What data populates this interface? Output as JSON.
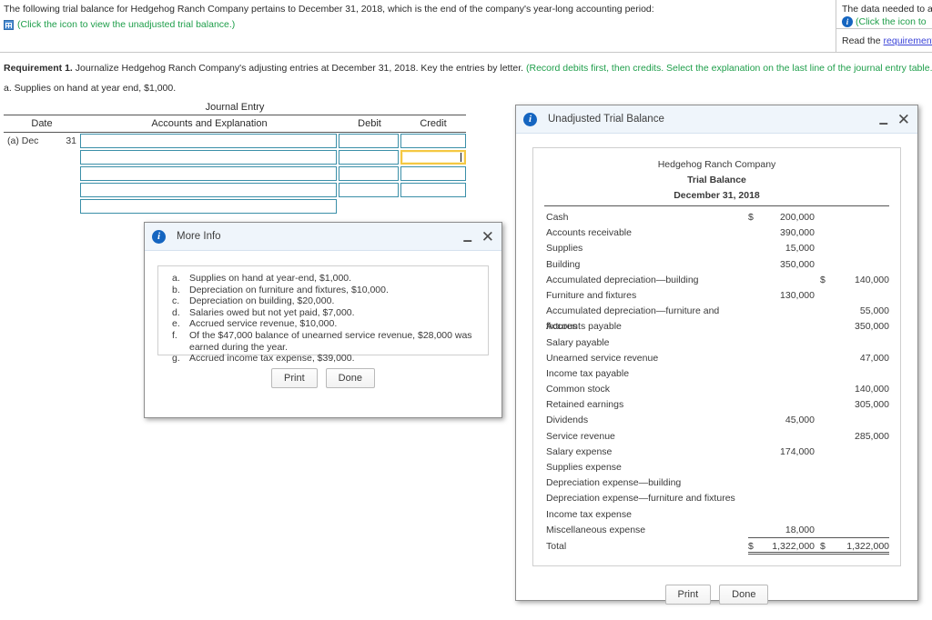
{
  "problem": {
    "statement": "The following trial balance for Hedgehog Ranch Company pertains to December 31, 2018, which is the end of the company's year-long accounting period:",
    "grid_icon": "table-grid-icon",
    "click_icon_text": "(Click the icon to view the unadjusted trial balance.)",
    "right_line1": "The data needed to a",
    "right_info_icon": "info-circle-icon",
    "right_click_text": "(Click the icon to",
    "right_read_prefix": "Read the ",
    "right_read_link": "requirement"
  },
  "requirement": {
    "label": "Requirement 1.",
    "text": " Journalize Hedgehog Ranch Company's adjusting entries at December 31, 2018. Key the entries by letter. ",
    "hint": "(Record debits first, then credits. Select the explanation on the last line of the journal entry table.)",
    "sub_item": "a. Supplies on hand at year end, $1,000."
  },
  "journal": {
    "title": "Journal Entry",
    "columns": {
      "date": "Date",
      "accounts": "Accounts and Explanation",
      "debit": "Debit",
      "credit": "Credit"
    },
    "rows": [
      {
        "date_label": "(a) Dec",
        "date_day": "31",
        "accounts_value": "",
        "debit_value": "",
        "credit_value": "",
        "has_amounts": true,
        "focused": ""
      },
      {
        "date_label": "",
        "date_day": "",
        "accounts_value": "",
        "debit_value": "",
        "credit_value": "",
        "has_amounts": true,
        "focused": "credit"
      },
      {
        "date_label": "",
        "date_day": "",
        "accounts_value": "",
        "debit_value": "",
        "credit_value": "",
        "has_amounts": true,
        "focused": ""
      },
      {
        "date_label": "",
        "date_day": "",
        "accounts_value": "",
        "debit_value": "",
        "credit_value": "",
        "has_amounts": true,
        "focused": ""
      },
      {
        "date_label": "",
        "date_day": "",
        "accounts_value": "",
        "debit_value": "",
        "credit_value": "",
        "has_amounts": false,
        "focused": ""
      }
    ]
  },
  "more_info_dialog": {
    "title": "More Info",
    "info_icon": "info-circle-icon",
    "minimize_glyph": "–",
    "close_glyph": "✕",
    "items": [
      {
        "key": "a.",
        "text": "Supplies on hand at year-end, $1,000."
      },
      {
        "key": "b.",
        "text": "Depreciation on furniture and fixtures, $10,000."
      },
      {
        "key": "c.",
        "text": "Depreciation on building, $20,000."
      },
      {
        "key": "d.",
        "text": "Salaries owed but not yet paid, $7,000."
      },
      {
        "key": "e.",
        "text": "Accrued service revenue, $10,000."
      },
      {
        "key": "f.",
        "text": "Of the $47,000 balance of unearned service revenue, $28,000 was earned during the year."
      },
      {
        "key": "g.",
        "text": "Accrued income tax expense, $39,000."
      }
    ],
    "print_label": "Print",
    "done_label": "Done"
  },
  "trial_balance_dialog": {
    "title": "Unadjusted Trial Balance",
    "info_icon": "info-circle-icon",
    "minimize_glyph": "–",
    "close_glyph": "✕",
    "company": "Hedgehog Ranch Company",
    "report": "Trial Balance",
    "date": "December 31, 2018",
    "rows": [
      {
        "name": "Cash",
        "debit_sym": "$",
        "debit": "200,000",
        "credit_sym": "",
        "credit": ""
      },
      {
        "name": "Accounts receivable",
        "debit_sym": "",
        "debit": "390,000",
        "credit_sym": "",
        "credit": ""
      },
      {
        "name": "Supplies",
        "debit_sym": "",
        "debit": "15,000",
        "credit_sym": "",
        "credit": ""
      },
      {
        "name": "Building",
        "debit_sym": "",
        "debit": "350,000",
        "credit_sym": "",
        "credit": ""
      },
      {
        "name": "Accumulated depreciation—building",
        "debit_sym": "",
        "debit": "",
        "credit_sym": "$",
        "credit": "140,000"
      },
      {
        "name": "Furniture and fixtures",
        "debit_sym": "",
        "debit": "130,000",
        "credit_sym": "",
        "credit": ""
      },
      {
        "name": "Accumulated depreciation—furniture and fixtures",
        "debit_sym": "",
        "debit": "",
        "credit_sym": "",
        "credit": "55,000"
      },
      {
        "name": "Accounts payable",
        "debit_sym": "",
        "debit": "",
        "credit_sym": "",
        "credit": "350,000"
      },
      {
        "name": "Salary payable",
        "debit_sym": "",
        "debit": "",
        "credit_sym": "",
        "credit": ""
      },
      {
        "name": "Unearned service revenue",
        "debit_sym": "",
        "debit": "",
        "credit_sym": "",
        "credit": "47,000"
      },
      {
        "name": "Income tax payable",
        "debit_sym": "",
        "debit": "",
        "credit_sym": "",
        "credit": ""
      },
      {
        "name": "Common stock",
        "debit_sym": "",
        "debit": "",
        "credit_sym": "",
        "credit": "140,000"
      },
      {
        "name": "Retained earnings",
        "debit_sym": "",
        "debit": "",
        "credit_sym": "",
        "credit": "305,000"
      },
      {
        "name": "Dividends",
        "debit_sym": "",
        "debit": "45,000",
        "credit_sym": "",
        "credit": ""
      },
      {
        "name": "Service revenue",
        "debit_sym": "",
        "debit": "",
        "credit_sym": "",
        "credit": "285,000"
      },
      {
        "name": "Salary expense",
        "debit_sym": "",
        "debit": "174,000",
        "credit_sym": "",
        "credit": ""
      },
      {
        "name": "Supplies expense",
        "debit_sym": "",
        "debit": "",
        "credit_sym": "",
        "credit": ""
      },
      {
        "name": "Depreciation expense—building",
        "debit_sym": "",
        "debit": "",
        "credit_sym": "",
        "credit": ""
      },
      {
        "name": "Depreciation expense—furniture and fixtures",
        "debit_sym": "",
        "debit": "",
        "credit_sym": "",
        "credit": ""
      },
      {
        "name": "Income tax expense",
        "debit_sym": "",
        "debit": "",
        "credit_sym": "",
        "credit": ""
      },
      {
        "name": "Miscellaneous expense",
        "debit_sym": "",
        "debit": "18,000",
        "credit_sym": "",
        "credit": "",
        "ruled": true
      }
    ],
    "total": {
      "name": "Total",
      "debit_sym": "$",
      "debit": "1,322,000",
      "credit_sym": "$",
      "credit": "1,322,000"
    },
    "print_label": "Print",
    "done_label": "Done"
  },
  "colors": {
    "green_text": "#1e9e4a",
    "link": "#3b44d8",
    "cell_border": "#3a8fa8",
    "focus_border": "#f5c842",
    "titlebar_bg": "#eff5fb",
    "info_blue": "#1565c0"
  }
}
